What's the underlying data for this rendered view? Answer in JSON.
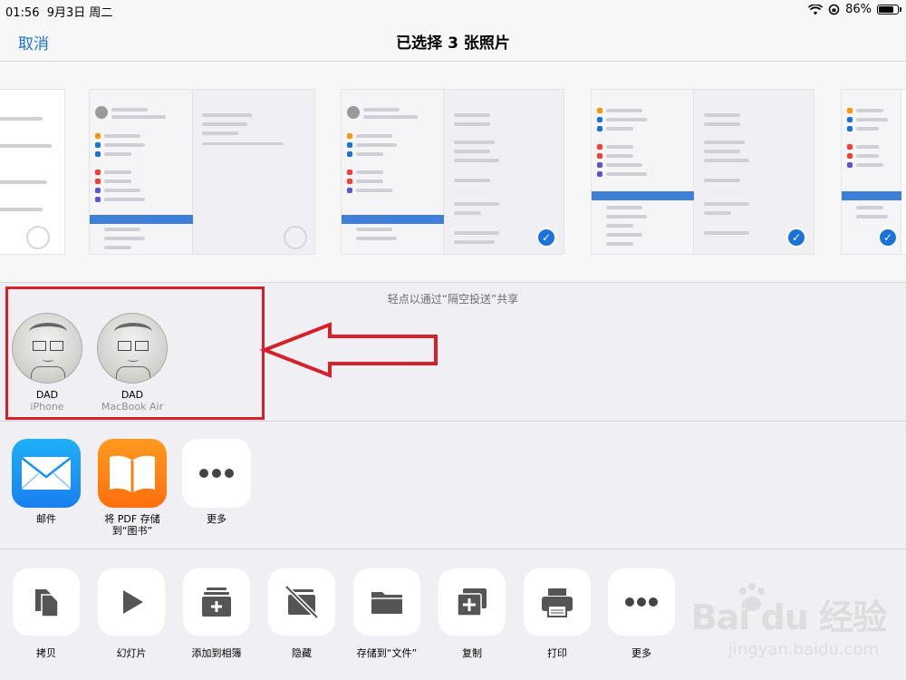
{
  "status_bar": {
    "time": "01:56",
    "date": "9月3日 周二",
    "battery": "86%",
    "battery_level": 0.86,
    "icons": [
      "wifi-icon",
      "orientation-lock-icon",
      "battery-icon"
    ]
  },
  "nav": {
    "cancel_label": "取消",
    "title": "已选择 3 张照片"
  },
  "photos": {
    "selected_count": 3,
    "check_mark": "✓"
  },
  "airdrop": {
    "hint": "轻点以通过“隔空投送”共享",
    "devices": [
      {
        "name": "DAD",
        "type": "iPhone"
      },
      {
        "name": "DAD",
        "type": "MacBook Air"
      }
    ]
  },
  "apps": [
    {
      "label": "邮件",
      "icon": "mail-icon"
    },
    {
      "label": "将 PDF 存储\n到“图书”",
      "icon": "books-icon"
    },
    {
      "label": "更多",
      "icon": "more-icon"
    }
  ],
  "actions": [
    {
      "label": "拷贝",
      "icon": "copy-icon"
    },
    {
      "label": "幻灯片",
      "icon": "play-icon"
    },
    {
      "label": "添加到相簿",
      "icon": "add-to-album-icon"
    },
    {
      "label": "隐藏",
      "icon": "hide-icon"
    },
    {
      "label": "存储到“文件”",
      "icon": "folder-icon"
    },
    {
      "label": "复制",
      "icon": "duplicate-icon"
    },
    {
      "label": "打印",
      "icon": "print-icon"
    },
    {
      "label": "更多",
      "icon": "more-icon"
    }
  ],
  "watermark": {
    "logo": "Bai du 经验",
    "url": "jingyan.baidu.com"
  },
  "colors": {
    "accent": "#1a73d9",
    "annotation": "#d6202a"
  }
}
